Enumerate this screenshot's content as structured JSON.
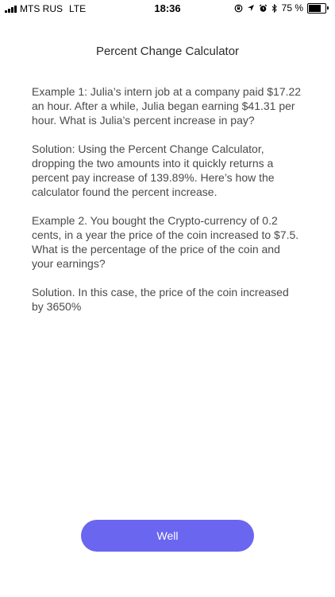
{
  "status_bar": {
    "carrier": "MTS RUS",
    "network": "LTE",
    "time": "18:36",
    "battery_text": "75 %",
    "battery_level": 0.75,
    "icons": [
      "lock-rotation-icon",
      "location-icon",
      "alarm-icon",
      "bluetooth-icon"
    ]
  },
  "page": {
    "title": "Percent Change Calculator",
    "paragraphs": [
      "Example 1: Julia’s intern job at a company paid $17.22 an hour. After a while, Julia began earning $41.31 per hour. What is Julia’s percent increase in pay?",
      "Solution: Using the Percent Change Calculator, dropping the two amounts into it quickly returns a percent pay increase of 139.89%. Here’s how the calculator found the percent increase.",
      "Example 2. You bought the Crypto-currency of 0.2 cents, in a year the price of the coin increased to $7.5. What is the percentage of the price of the coin and your earnings?",
      "Solution. In this case, the price of the coin increased by 3650%"
    ],
    "button_label": "Well"
  },
  "colors": {
    "accent": "#6b66f0",
    "text": "#4a4a4c",
    "background": "#ffffff"
  }
}
